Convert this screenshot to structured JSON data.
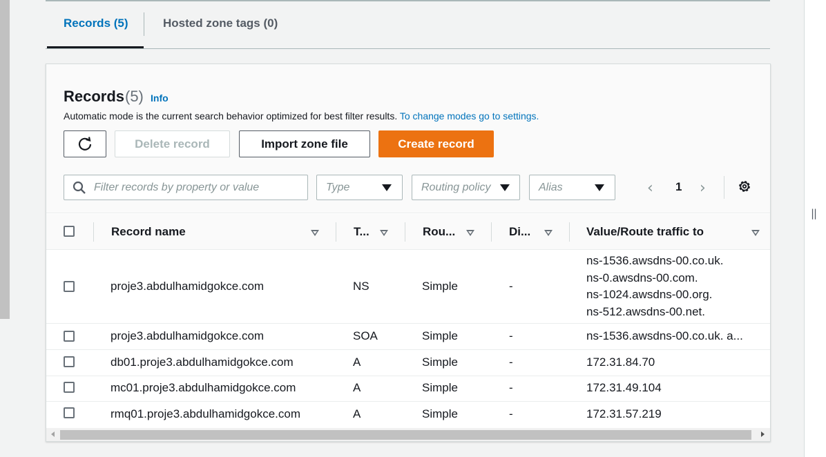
{
  "tabs": [
    {
      "label": "Records (5)"
    },
    {
      "label": "Hosted zone tags (0)"
    }
  ],
  "panel": {
    "title": "Records",
    "count": "(5)",
    "info_link": "Info",
    "description": "Automatic mode is the current search behavior optimized for best filter results.",
    "description_link": "To change modes go to settings."
  },
  "actions": {
    "refresh_icon": "refresh-icon",
    "delete": "Delete record",
    "import": "Import zone file",
    "create": "Create record"
  },
  "filters": {
    "search_placeholder": "Filter records by property or value",
    "type_placeholder": "Type",
    "routing_placeholder": "Routing policy",
    "alias_placeholder": "Alias"
  },
  "pagination": {
    "prev": "‹",
    "page": "1",
    "next": "›"
  },
  "table": {
    "columns": [
      "Record name",
      "T...",
      "Rou...",
      "Di...",
      "Value/Route traffic to"
    ],
    "rows": [
      {
        "name": "proje3.abdulhamidgokce.com",
        "type": "NS",
        "routing": "Simple",
        "differentiator": "-",
        "value": [
          "ns-1536.awsdns-00.co.uk.",
          "ns-0.awsdns-00.com.",
          "ns-1024.awsdns-00.org.",
          "ns-512.awsdns-00.net."
        ]
      },
      {
        "name": "proje3.abdulhamidgokce.com",
        "type": "SOA",
        "routing": "Simple",
        "differentiator": "-",
        "value": [
          "ns-1536.awsdns-00.co.uk. a..."
        ]
      },
      {
        "name": "db01.proje3.abdulhamidgokce.com",
        "type": "A",
        "routing": "Simple",
        "differentiator": "-",
        "value": [
          "172.31.84.70"
        ]
      },
      {
        "name": "mc01.proje3.abdulhamidgokce.com",
        "type": "A",
        "routing": "Simple",
        "differentiator": "-",
        "value": [
          "172.31.49.104"
        ]
      },
      {
        "name": "rmq01.proje3.abdulhamidgokce.com",
        "type": "A",
        "routing": "Simple",
        "differentiator": "-",
        "value": [
          "172.31.57.219"
        ]
      }
    ]
  },
  "colors": {
    "accent": "#0073bb",
    "primary_button": "#ec7211"
  }
}
